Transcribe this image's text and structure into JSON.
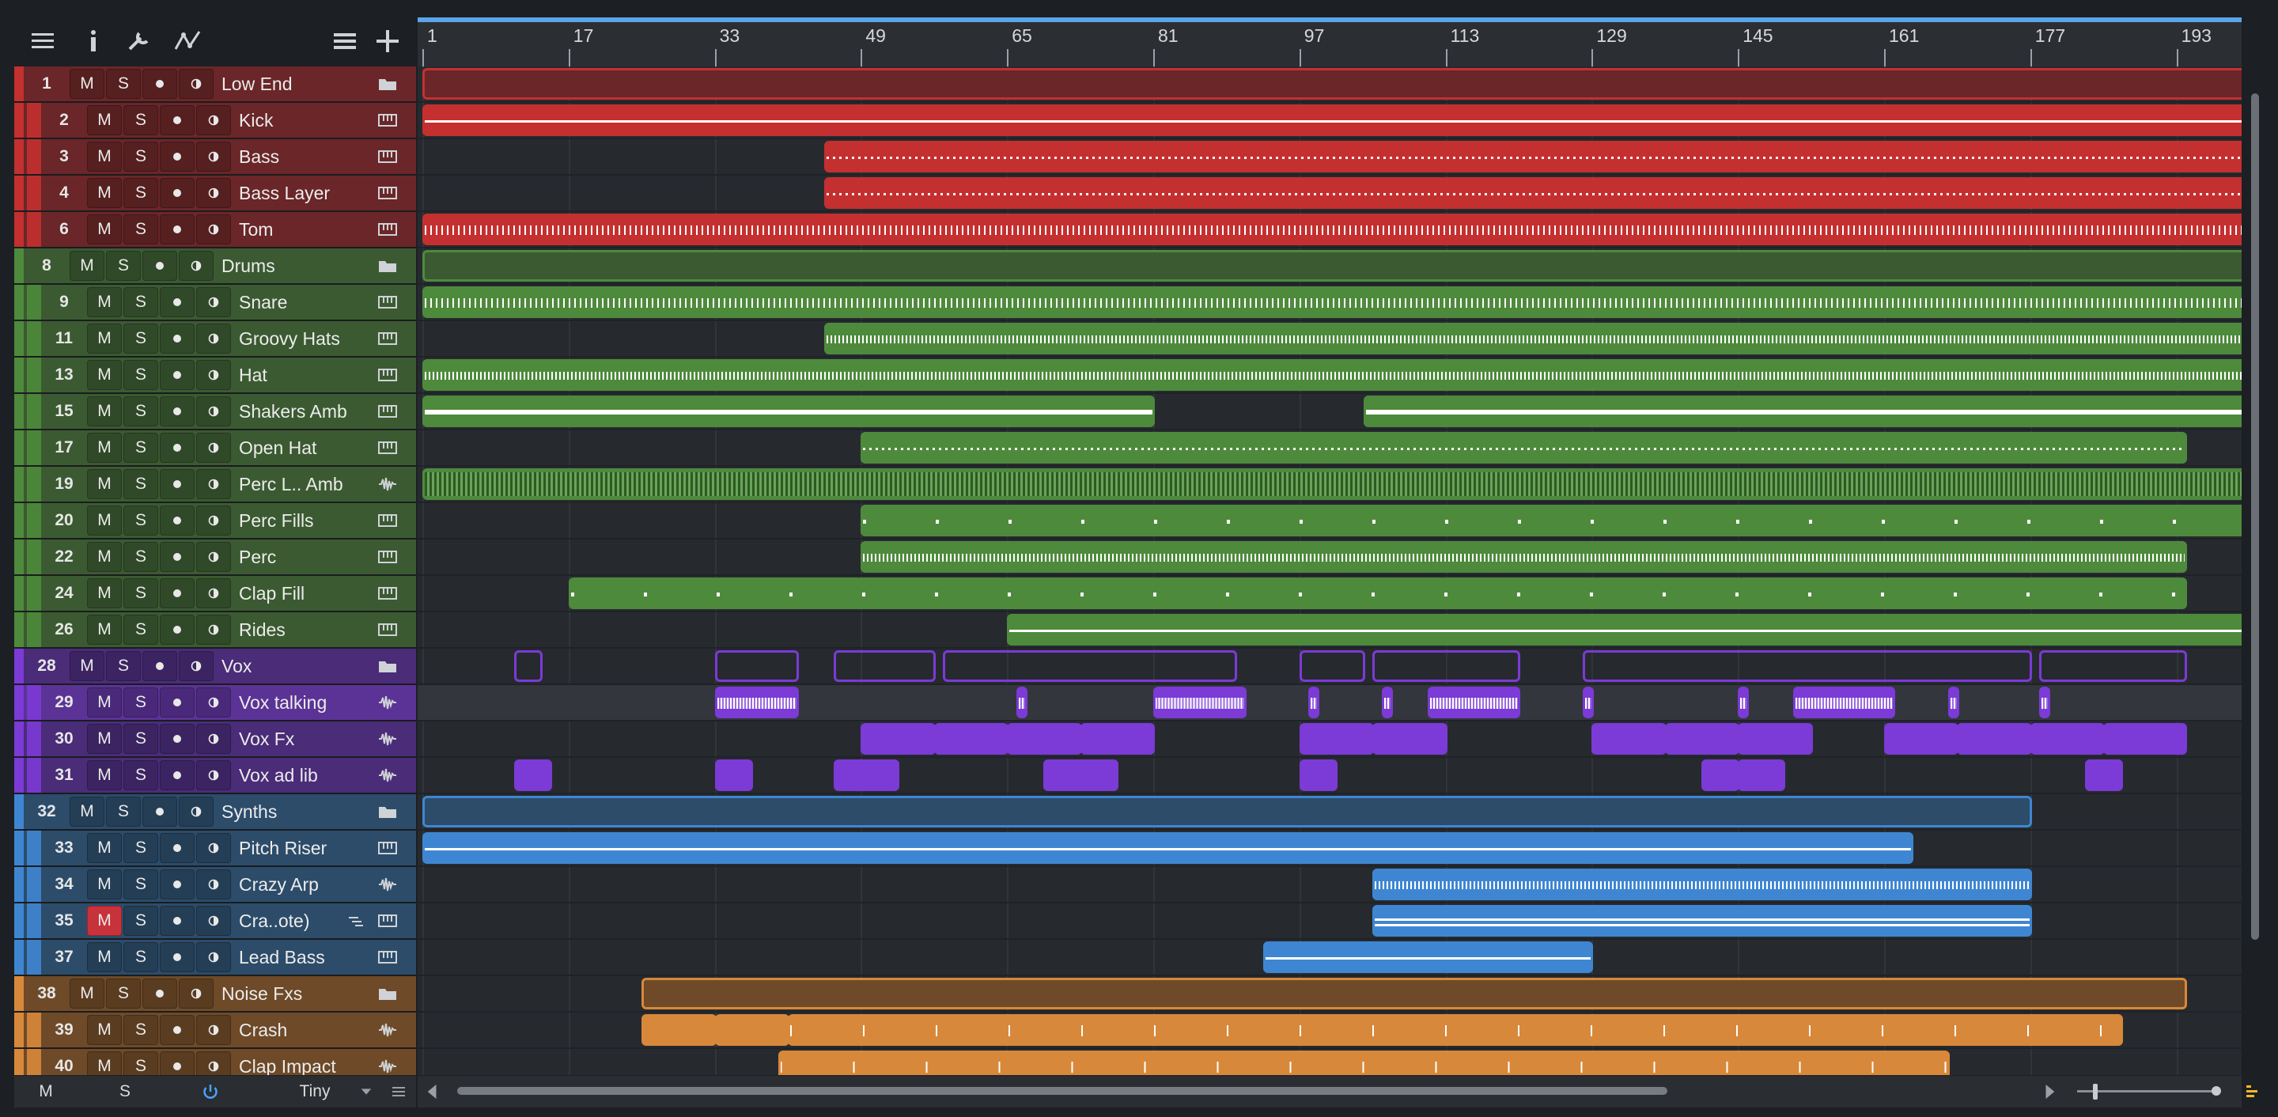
{
  "toolbar": {
    "icons": [
      "list-icon",
      "info-icon",
      "wrench-icon",
      "automation-icon",
      "tracklist-icon",
      "add-icon"
    ]
  },
  "ruler": {
    "labels": [
      "1",
      "17",
      "33",
      "49",
      "65",
      "81",
      "97",
      "113",
      "129",
      "145",
      "161",
      "177",
      "193"
    ]
  },
  "colors": {
    "red": "#c4302f",
    "green": "#4e8a3c",
    "purple": "#7c3ad6",
    "blue": "#3f86d2",
    "orange": "#d8883a"
  },
  "tracks": [
    {
      "num": "1",
      "name": "Low End",
      "type": "folder",
      "color": "red",
      "mute": "M",
      "solo": "S"
    },
    {
      "num": "2",
      "name": "Kick",
      "type": "instrument",
      "color": "red",
      "mute": "M",
      "solo": "S"
    },
    {
      "num": "3",
      "name": "Bass",
      "type": "instrument",
      "color": "red",
      "mute": "M",
      "solo": "S"
    },
    {
      "num": "4",
      "name": "Bass Layer",
      "type": "instrument",
      "color": "red",
      "mute": "M",
      "solo": "S"
    },
    {
      "num": "6",
      "name": "Tom",
      "type": "instrument",
      "color": "red",
      "mute": "M",
      "solo": "S"
    },
    {
      "num": "8",
      "name": "Drums",
      "type": "folder",
      "color": "green",
      "mute": "M",
      "solo": "S"
    },
    {
      "num": "9",
      "name": "Snare",
      "type": "instrument",
      "color": "green",
      "mute": "M",
      "solo": "S"
    },
    {
      "num": "11",
      "name": "Groovy Hats",
      "type": "instrument",
      "color": "green",
      "mute": "M",
      "solo": "S"
    },
    {
      "num": "13",
      "name": "Hat",
      "type": "instrument",
      "color": "green",
      "mute": "M",
      "solo": "S"
    },
    {
      "num": "15",
      "name": "Shakers Amb",
      "type": "instrument",
      "color": "green",
      "mute": "M",
      "solo": "S"
    },
    {
      "num": "17",
      "name": "Open Hat",
      "type": "instrument",
      "color": "green",
      "mute": "M",
      "solo": "S"
    },
    {
      "num": "19",
      "name": "Perc L.. Amb",
      "type": "audio",
      "color": "green",
      "mute": "M",
      "solo": "S"
    },
    {
      "num": "20",
      "name": "Perc Fills",
      "type": "instrument",
      "color": "green",
      "mute": "M",
      "solo": "S"
    },
    {
      "num": "22",
      "name": "Perc",
      "type": "instrument",
      "color": "green",
      "mute": "M",
      "solo": "S"
    },
    {
      "num": "24",
      "name": "Clap Fill",
      "type": "instrument",
      "color": "green",
      "mute": "M",
      "solo": "S"
    },
    {
      "num": "26",
      "name": "Rides",
      "type": "instrument",
      "color": "green",
      "mute": "M",
      "solo": "S"
    },
    {
      "num": "28",
      "name": "Vox",
      "type": "folder",
      "color": "purple",
      "mute": "M",
      "solo": "S"
    },
    {
      "num": "29",
      "name": "Vox talking",
      "type": "audio",
      "color": "purple",
      "mute": "M",
      "solo": "S",
      "selected": true
    },
    {
      "num": "30",
      "name": "Vox Fx",
      "type": "audio",
      "color": "purple",
      "mute": "M",
      "solo": "S"
    },
    {
      "num": "31",
      "name": "Vox ad lib",
      "type": "audio",
      "color": "purple",
      "mute": "M",
      "solo": "S"
    },
    {
      "num": "32",
      "name": "Synths",
      "type": "folder",
      "color": "blue",
      "mute": "M",
      "solo": "S"
    },
    {
      "num": "33",
      "name": "Pitch Riser",
      "type": "instrument",
      "color": "blue",
      "mute": "M",
      "solo": "S"
    },
    {
      "num": "34",
      "name": "Crazy Arp",
      "type": "audio",
      "color": "blue",
      "mute": "M",
      "solo": "S"
    },
    {
      "num": "35",
      "name": "Cra..ote)",
      "type": "instrument",
      "color": "blue",
      "mute": "M",
      "solo": "S",
      "muted": true
    },
    {
      "num": "37",
      "name": "Lead Bass",
      "type": "instrument",
      "color": "blue",
      "mute": "M",
      "solo": "S"
    },
    {
      "num": "38",
      "name": "Noise Fxs",
      "type": "folder",
      "color": "orange",
      "mute": "M",
      "solo": "S"
    },
    {
      "num": "39",
      "name": "Crash",
      "type": "audio",
      "color": "orange",
      "mute": "M",
      "solo": "S"
    },
    {
      "num": "40",
      "name": "Clap Impact",
      "type": "audio",
      "color": "orange",
      "mute": "M",
      "solo": "S"
    }
  ],
  "bottom": {
    "mute_all": "M",
    "solo_all": "S",
    "size": "Tiny"
  }
}
